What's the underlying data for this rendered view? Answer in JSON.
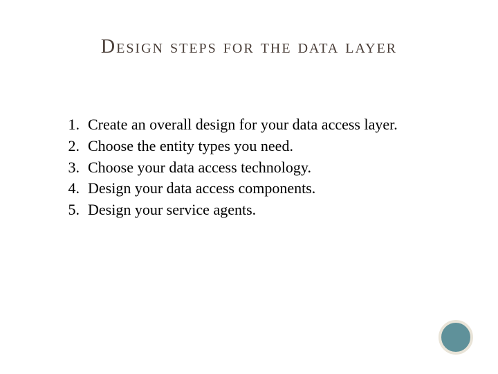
{
  "title": "Design steps for the data layer",
  "steps": [
    "Create an overall design for your data access layer.",
    "Choose the entity types you need.",
    "Choose your data access technology.",
    "Design your data access components.",
    "Design your service agents."
  ]
}
